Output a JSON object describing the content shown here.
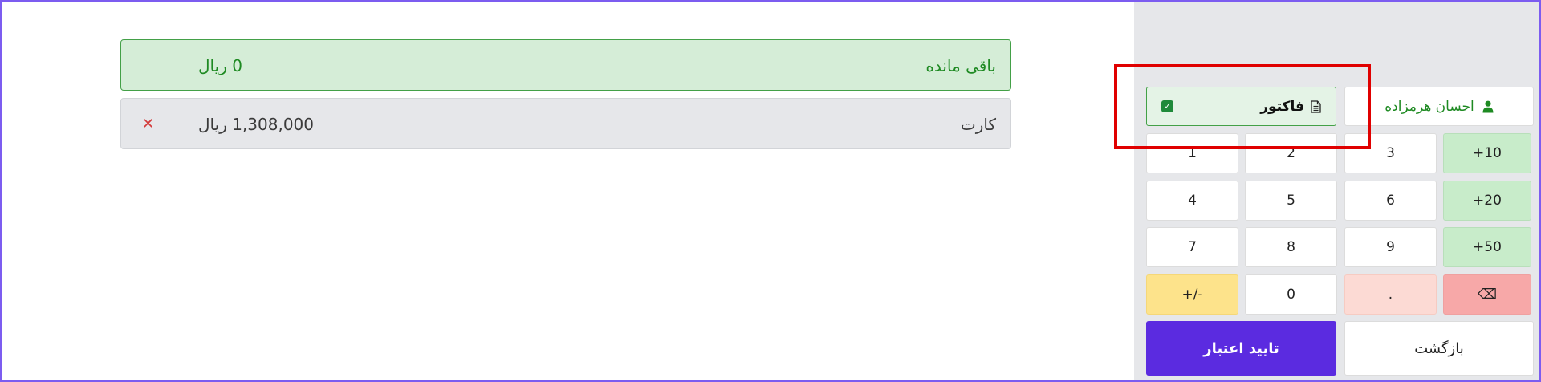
{
  "payments": {
    "remaining": {
      "label": "باقی مانده",
      "amount": "0 ریال"
    },
    "card": {
      "label": "کارت",
      "amount": "1,308,000 ریال",
      "remove_icon": "✕"
    }
  },
  "tabs": {
    "user": {
      "name": "احسان هرمزاده",
      "icon": "user-icon"
    },
    "invoice": {
      "label": "فاکتور",
      "icon": "document-icon",
      "checked": true
    }
  },
  "keypad": {
    "plus10": "+10",
    "plus20": "+20",
    "plus50": "+50",
    "k1": "1",
    "k2": "2",
    "k3": "3",
    "k4": "4",
    "k5": "5",
    "k6": "6",
    "k7": "7",
    "k8": "8",
    "k9": "9",
    "k0": "0",
    "decimal": ".",
    "sign": "+/-",
    "backspace": "⌫"
  },
  "actions": {
    "back": "بازگشت",
    "confirm": "تایید اعتبار"
  },
  "colors": {
    "accent": "#5b2be0",
    "success": "#43a047",
    "highlight": "#e00000"
  }
}
